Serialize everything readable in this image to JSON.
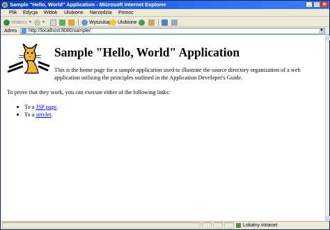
{
  "window": {
    "title": "Sample \"Hello, World\" Application - Microsoft Internet Explorer",
    "buttons": {
      "minimize": "_",
      "maximize": "□",
      "close": "×"
    }
  },
  "menubar": {
    "items": [
      {
        "label": "Plik"
      },
      {
        "label": "Edycja"
      },
      {
        "label": "Widok"
      },
      {
        "label": "Ulubione"
      },
      {
        "label": "Narzędzia"
      },
      {
        "label": "Pomoc"
      }
    ]
  },
  "toolbar": {
    "back_label": "Wstecz",
    "search_label": "Wyszukaj",
    "favorites_label": "Ulubione"
  },
  "addressbar": {
    "label": "Adres",
    "url": "http://localhost:8080/sample/"
  },
  "page": {
    "heading": "Sample \"Hello, World\" Application",
    "intro": "This is the home page for a sample application used to illustrate the source directory organization of a web application utilizing the principles outlined in the Application Developer's Guide.",
    "prove_text": "To prove that they work, you can execute either of the following links:",
    "links": [
      {
        "prefix": "To a ",
        "link_text": "JSP page",
        "suffix": "."
      },
      {
        "prefix": "To a ",
        "link_text": "servlet",
        "suffix": "."
      }
    ]
  },
  "statusbar": {
    "zone": "Lokalny intranet"
  },
  "colors": {
    "titlebar": "#2f6ef0",
    "link": "#0000ee",
    "chrome": "#ece9d8"
  }
}
